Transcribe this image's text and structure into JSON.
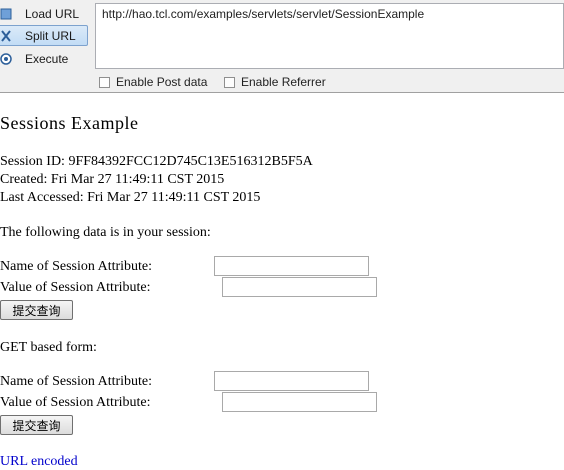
{
  "toolbar": {
    "load_url": "Load URL",
    "split_url": "Split URL",
    "execute": "Execute",
    "url_value": "http://hao.tcl.com/examples/servlets/servlet/SessionExample",
    "enable_post_data": "Enable Post data",
    "enable_referrer": "Enable Referrer"
  },
  "page": {
    "title": "Sessions Example",
    "session_id": "Session ID: 9FF84392FCC12D745C13E516312B5F5A",
    "created": "Created: Fri Mar 27 11:49:11 CST 2015",
    "last_accessed": "Last Accessed: Fri Mar 27 11:49:11 CST 2015",
    "data_intro": "The following data is in your session:",
    "post_form": {
      "name_label": "Name of Session Attribute:",
      "value_label": "Value of Session Attribute:",
      "submit": "提交查询"
    },
    "get_heading": "GET based form:",
    "get_form": {
      "name_label": "Name of Session Attribute:",
      "value_label": "Value of Session Attribute:",
      "submit": "提交查询"
    },
    "url_encoded_link": "URL encoded"
  }
}
